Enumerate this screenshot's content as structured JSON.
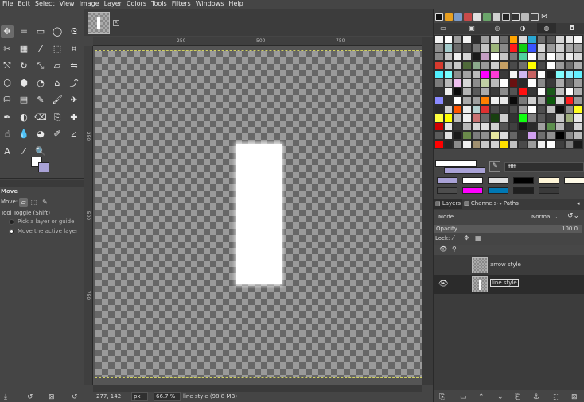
{
  "menu": [
    "File",
    "Edit",
    "Select",
    "View",
    "Image",
    "Layer",
    "Colors",
    "Tools",
    "Filters",
    "Windows",
    "Help"
  ],
  "toolbox": {
    "tools": [
      {
        "icon": "move-icon",
        "glyph": "✥"
      },
      {
        "icon": "align-icon",
        "glyph": "⊨"
      },
      {
        "icon": "rect-select-icon",
        "glyph": "▭"
      },
      {
        "icon": "ellipse-select-icon",
        "glyph": "◯"
      },
      {
        "icon": "lasso-icon",
        "glyph": "ᘓ"
      },
      {
        "icon": "scissors-select-icon",
        "glyph": "✂"
      },
      {
        "icon": "by-color-select-icon",
        "glyph": "▦"
      },
      {
        "icon": "fuzzy-select-icon",
        "glyph": "⁄"
      },
      {
        "icon": "foreground-select-icon",
        "glyph": "⬚"
      },
      {
        "icon": "crop-icon",
        "glyph": "⌗"
      },
      {
        "icon": "unified-transform-icon",
        "glyph": "⤲"
      },
      {
        "icon": "rotate-icon",
        "glyph": "↻"
      },
      {
        "icon": "scale-icon",
        "glyph": "⤡"
      },
      {
        "icon": "shear-icon",
        "glyph": "▱"
      },
      {
        "icon": "flip-icon",
        "glyph": "⇋"
      },
      {
        "icon": "perspective-icon",
        "glyph": "⬡"
      },
      {
        "icon": "cage-icon",
        "glyph": "⬢"
      },
      {
        "icon": "warp-icon",
        "glyph": "◔"
      },
      {
        "icon": "handle-transform-icon",
        "glyph": "⌂"
      },
      {
        "icon": "text-path-icon",
        "glyph": "⤴"
      },
      {
        "icon": "bucket-fill-icon",
        "glyph": "⛁"
      },
      {
        "icon": "gradient-icon",
        "glyph": "▤"
      },
      {
        "icon": "pencil-icon",
        "glyph": "✎"
      },
      {
        "icon": "paintbrush-icon",
        "glyph": "🖌"
      },
      {
        "icon": "airbrush-icon",
        "glyph": "✈"
      },
      {
        "icon": "ink-icon",
        "glyph": "✒"
      },
      {
        "icon": "mypaint-brush-icon",
        "glyph": "◐"
      },
      {
        "icon": "eraser-icon",
        "glyph": "⌫"
      },
      {
        "icon": "clone-icon",
        "glyph": "⎘"
      },
      {
        "icon": "heal-icon",
        "glyph": "✚"
      },
      {
        "icon": "smudge-icon",
        "glyph": "☝"
      },
      {
        "icon": "blur-icon",
        "glyph": "💧"
      },
      {
        "icon": "dodge-icon",
        "glyph": "◕"
      },
      {
        "icon": "paths-icon",
        "glyph": "✐"
      },
      {
        "icon": "measure-icon",
        "glyph": "⊿"
      },
      {
        "icon": "text-icon",
        "glyph": "A"
      },
      {
        "icon": "color-picker-icon",
        "glyph": "⁄"
      },
      {
        "icon": "zoom-icon",
        "glyph": "🔍"
      }
    ],
    "options_title": "Move",
    "move_label": "Move:",
    "tool_toggle": "Tool Toggle  (Shift)",
    "radio_pick": "Pick a layer or guide",
    "radio_move": "Move the active layer"
  },
  "ruler": {
    "h_ticks": [
      "250",
      "500",
      "750"
    ],
    "v_ticks": [
      "250",
      "500",
      "750"
    ]
  },
  "status": {
    "coords": "277, 142",
    "unit": "px",
    "zoom": "66.7 %",
    "message": "line style (98.8 MB)"
  },
  "colors": {
    "foreground": "#ffffff",
    "background": "#a9a2d6",
    "hex": "ffffff"
  },
  "palette": [
    "#f2f2f2",
    "#ffffff",
    "#9d9d9d",
    "#f2f2f2",
    "#2c2c2c",
    "#9c9c9c",
    "#dcdcdc",
    "#6c6c6c",
    "#ffa500",
    "#d9d9d9",
    "#2aa6d1",
    "#6d6d6d",
    "#5a5a5a",
    "#d5d5d5",
    "#e6e6e6",
    "#fafafa",
    "#8f8f8f",
    "#a3cbcb",
    "#6b6b6b",
    "#4d4d4d",
    "#777777",
    "#c5c5c5",
    "#9db67b",
    "#8a8a8a",
    "#ff1a1a",
    "#10d010",
    "#3a55ff",
    "#d7d7d7",
    "#9a9a9a",
    "#cfcfcf",
    "#a8a8a8",
    "#a0a0a0",
    "#8a8a8a",
    "#c8c8c8",
    "#efefef",
    "#d5d5d5",
    "#1a1a1a",
    "#c49ec3",
    "#ffffff",
    "#c6c6c6",
    "#7a7a7a",
    "#50d0a0",
    "#fffefe",
    "#bdbdbd",
    "#ffffff",
    "#cfcfcf",
    "#ededed",
    "#d9d9d9",
    "#d73a2e",
    "#b3b3b3",
    "#c8c8c8",
    "#4f6a3a",
    "#8caa8c",
    "#9a9a9a",
    "#cfcfcf",
    "#c5a064",
    "#4a4a4a",
    "#6e6e6e",
    "#ffff00",
    "#4a4a4a",
    "#ffffff",
    "#9a9a9a",
    "#6f6f6f",
    "#adadad",
    "#50f0ff",
    "#78ffff",
    "#8d8d8d",
    "#a3a3a3",
    "#bcbcbc",
    "#ff00ff",
    "#ff3ad7",
    "#3a3a3a",
    "#f4f4f4",
    "#d0b8f0",
    "#c86464",
    "#ffffff",
    "#1f1f1f",
    "#80ffff",
    "#8af0ff",
    "#63f0ff",
    "#7c7c7c",
    "#b8b8b8",
    "#f0c0f0",
    "#d7d7d7",
    "#8d8d8d",
    "#c1d0a4",
    "#bbbbbb",
    "#ffffff",
    "#6a1010",
    "#2a2a2a",
    "#ffffff",
    "#8a8a8a",
    "#3a3a3a",
    "#aaaaaa",
    "#5f5f5f",
    "#9e9e9e",
    "#323232",
    "#ededed",
    "#0a0a0a",
    "#b4b4b4",
    "#5a5a5a",
    "#ababab",
    "#3a3a3a",
    "#8c8c8c",
    "#545454",
    "#ff1010",
    "#363636",
    "#ffffff",
    "#1a5a1a",
    "#c0c0c0",
    "#ffffff",
    "#b0b0b0",
    "#8a8aff",
    "#2d2d2d",
    "#ffffff",
    "#aaaaaa",
    "#9f9f9f",
    "#ff8000",
    "#efefef",
    "#e8e8e8",
    "#0a0a0a",
    "#7a7a7a",
    "#d0d0d0",
    "#a6a6a6",
    "#0c5a0c",
    "#d9d9d9",
    "#ff2020",
    "#9a9a9a",
    "#2a2a2a",
    "#d0d0d0",
    "#ff5500",
    "#eeeeee",
    "#b4d0d0",
    "#e03030",
    "#4c4c4c",
    "#3d3d3d",
    "#4a4a4a",
    "#9c9c9c",
    "#ffffff",
    "#4f4f4f",
    "#c1c1c1",
    "#0f0f0f",
    "#8f8f8f",
    "#ffff20",
    "#ffff40",
    "#ffff00",
    "#bdbdbd",
    "#f0f0f0",
    "#c97474",
    "#6a6a6a",
    "#184010",
    "#d0d0d0",
    "#333333",
    "#10ff10",
    "#808080",
    "#585858",
    "#3c3c3c",
    "#c7c7c7",
    "#9fae7d",
    "#e9e9e9",
    "#d10000",
    "#e6e6e6",
    "#3a3a3a",
    "#b7b7b7",
    "#d7d7d7",
    "#dddddd",
    "#cfcfcf",
    "#555555",
    "#404040",
    "#161616",
    "#2a2a2a",
    "#a0a0a0",
    "#5c8f4d",
    "#b7b7b7",
    "#3a3a3a",
    "#d4d4d4",
    "#5b5b5b",
    "#e0e0e0",
    "#1a1a1a",
    "#6a8a4a",
    "#7d7d7d",
    "#8f8f8f",
    "#e8e8a0",
    "#dadada",
    "#666666",
    "#2f2f2f",
    "#d0a0f0",
    "#6e6e6e",
    "#909090",
    "#000000",
    "#8d8d8d",
    "#bbbbbb",
    "#ff0000",
    "#282828",
    "#8c8c8c",
    "#f0f0f0",
    "#a09070",
    "#c8c8c8",
    "#d0d0d0",
    "#ffe000",
    "#c0c0c0",
    "#4a4a4a",
    "#9c9c9c",
    "#efefef",
    "#ffffff",
    "#3f3f3f",
    "#7c7c7c",
    "#1a1a1a"
  ],
  "history_colors": [
    "#a9a2d6",
    "#ffffff",
    "#e0e0e0",
    "#000000",
    "#fff6d8",
    "#fffbe8",
    "#4d4d4d",
    "#ff00ff",
    "#0078b4",
    "#1f1f1f",
    "#3a3a3a"
  ],
  "layers": {
    "tabs": [
      "Layers",
      "Channels",
      "Paths"
    ],
    "mode_label": "Mode",
    "mode_value": "Normal",
    "opacity_label": "Opacity",
    "opacity_value": "100.0",
    "lock_label": "Lock:",
    "items": [
      {
        "name": "arrow style",
        "visible": false,
        "selected": false
      },
      {
        "name": "line style",
        "visible": true,
        "selected": true
      }
    ]
  }
}
